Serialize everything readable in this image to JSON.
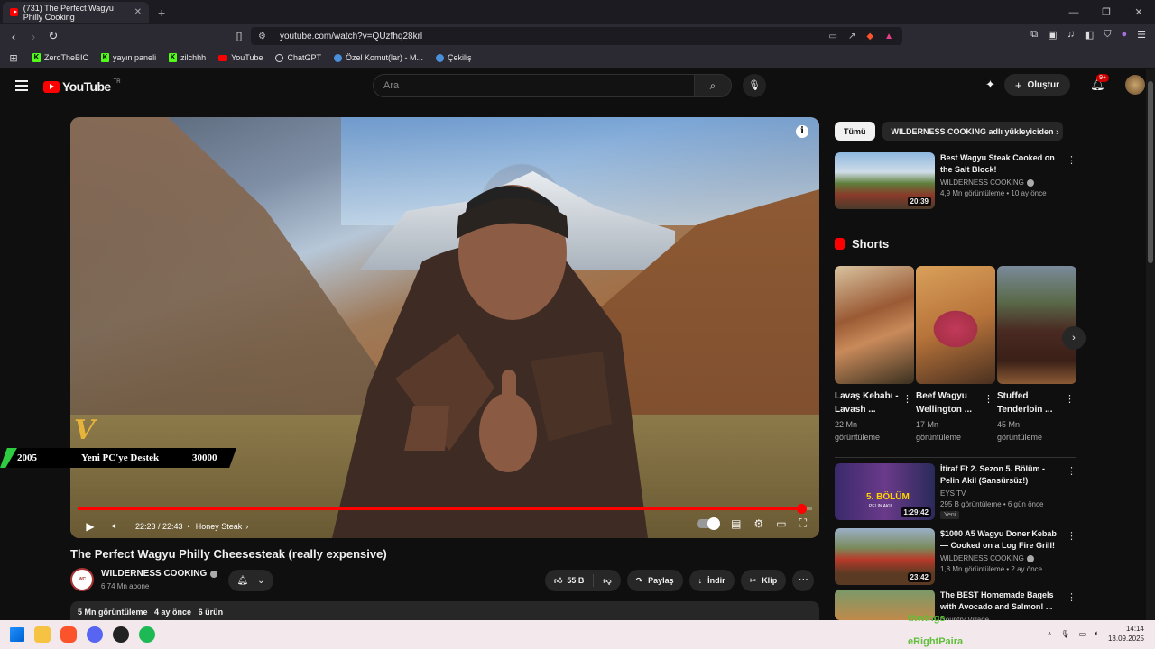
{
  "browser": {
    "tab_title": "(731) The Perfect Wagyu Philly Cooking",
    "url": "youtube.com/watch?v=QUzfhq28krl",
    "bookmarks": [
      {
        "label": "ZeroTheBIC",
        "icon": "kick-icon"
      },
      {
        "label": "yayın paneli",
        "icon": "kick-icon"
      },
      {
        "label": "zilchhh",
        "icon": "kick-icon"
      },
      {
        "label": "YouTube",
        "icon": "youtube-icon"
      },
      {
        "label": "ChatGPT",
        "icon": "chatgpt-icon"
      },
      {
        "label": "Özel Komut(lar) - M...",
        "icon": "globe-icon"
      },
      {
        "label": "Çekiliş",
        "icon": "globe-icon"
      }
    ]
  },
  "header": {
    "logo_text": "YouTube",
    "logo_country": "TR",
    "search_placeholder": "Ara",
    "create_label": "Oluştur",
    "notif_count": "9+"
  },
  "player": {
    "current_time": "22:23 / 22:43",
    "chapter": "Honey Steak",
    "progress": 0.985,
    "overlay": {
      "left": "2005",
      "middle": "Yeni PC'ye Destek",
      "right": "30000"
    }
  },
  "video": {
    "title": "The Perfect Wagyu Philly Cheesesteak (really expensive)",
    "channel": "WILDERNESS COOKING",
    "channel_avatar_text": "WILDERNESS COOKING",
    "subscribers": "6,74 Mn abone",
    "likes": "55 B",
    "share": "Paylaş",
    "download": "İndir",
    "clip": "Klip",
    "desc_views": "5 Mn görüntüleme",
    "desc_time": "4 ay önce",
    "desc_products": "6 ürün"
  },
  "sidebar": {
    "chips": [
      "Tümü",
      "WILDERNESS COOKING adlı yükleyiciden"
    ],
    "shorts_label": "Shorts",
    "top_rec": {
      "title": "Best Wagyu Steak Cooked on the Salt Block!",
      "channel": "WILDERNESS COOKING",
      "meta": "4,9 Mn görüntüleme • 10 ay önce",
      "duration": "20:39"
    },
    "shorts": [
      {
        "title": "Lavaş Kebabı - Lavash ...",
        "views": "22 Mn görüntüleme"
      },
      {
        "title": "Beef Wagyu Wellington ...",
        "views": "17 Mn görüntüleme"
      },
      {
        "title": "Stuffed Tenderloin ...",
        "views": "45 Mn görüntüleme"
      }
    ],
    "recs": [
      {
        "title": "İtiraf Et 2. Sezon 5. Bölüm - Pelin Akil (Sansürsüz!)",
        "channel": "EYS TV",
        "meta": "295 B görüntüleme • 6 gün önce",
        "badge": "Yeni",
        "duration": "1:29:42",
        "thumb_text": "5. BÖLÜM",
        "thumb_sub": "PELIN AKIL"
      },
      {
        "title": "$1000 A5 Wagyu Doner Kebab — Cooked on a Log Fire Grill!",
        "channel": "WILDERNESS COOKING",
        "meta": "1,8 Mn görüntüleme • 2 ay önce",
        "duration": "23:42"
      },
      {
        "title": "The BEST Homemade Bagels with Avocado and Salmon! ...",
        "channel": "Country Village"
      }
    ]
  },
  "taskbar": {
    "time": "14:14",
    "date": "13.09.2025",
    "ticker_top": "thwings",
    "ticker_bottom": "eRightPaira"
  },
  "colors": {
    "yt_red": "#ff0000",
    "bg": "#0f0f0f",
    "kick_green": "#53fc18"
  }
}
